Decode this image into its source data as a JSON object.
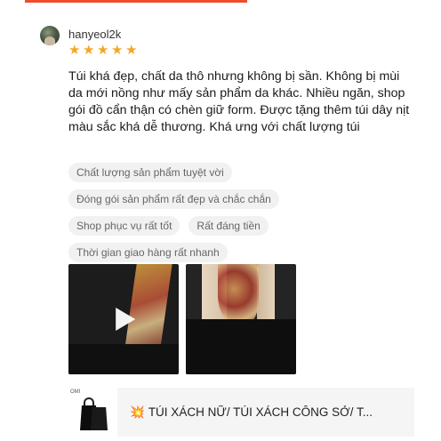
{
  "review": {
    "username": "hanyeol2k",
    "rating": 5,
    "stars": [
      "★",
      "★",
      "★",
      "★",
      "★"
    ],
    "text": "Túi khá đẹp, chất da thô nhưng không bị sần. Không bị mùi da mới nồng như mấy sản phẩm da khác. Nhiều ngăn, shop gói đồ cẩn thận có chèn giữ form. Được tặng thêm túi dây nịt màu sắc khá dễ thương. Khá ưng với chất lượng túi"
  },
  "tags": [
    "Chất lượng sản phẩm tuyệt vời",
    "Đóng gói sản phẩm rất đẹp và chắc chắn",
    "Shop phục vụ rất tốt",
    "Rất đáng tiền",
    "Thời gian giao hàng rất nhanh"
  ],
  "product": {
    "thumb_brand": "OMI",
    "emoji": "💥",
    "name": "TÚI XÁCH NỮ/ TÚI XÁCH CÔNG SỞ/ T..."
  },
  "colors": {
    "accent": "#ee4d2d",
    "star": "#f5a623",
    "tag_bg": "#f1f1f1"
  }
}
